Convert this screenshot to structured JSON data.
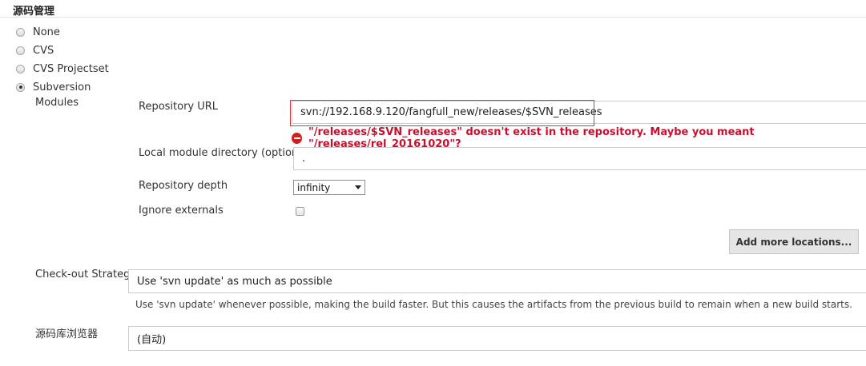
{
  "section": {
    "title": "源码管理"
  },
  "scm_options": [
    {
      "label": "None",
      "selected": false
    },
    {
      "label": "CVS",
      "selected": false
    },
    {
      "label": "CVS Projectset",
      "selected": false
    },
    {
      "label": "Subversion",
      "selected": true
    }
  ],
  "modules": {
    "label": "Modules",
    "repository_url_label": "Repository URL",
    "repository_url_value": "svn://192.168.9.120/fangfull_new/releases/$SVN_releases",
    "error_message": "\"/releases/$SVN_releases\" doesn't exist in the repository. Maybe you meant \"/releases/rel_20161020\"?",
    "local_dir_label": "Local module directory (optional)",
    "local_dir_value": ".",
    "depth_label": "Repository depth",
    "depth_value": "infinity",
    "ignore_externals_label": "Ignore externals",
    "ignore_externals_checked": false,
    "add_locations_label": "Add more locations..."
  },
  "checkout": {
    "label": "Check-out Strategy",
    "value": "Use 'svn update' as much as possible",
    "help": "Use 'svn update' whenever possible, making the build faster. But this causes the artifacts from the previous build to remain when a new build starts."
  },
  "browser": {
    "label": "源码库浏览器",
    "value": "(自动)"
  },
  "colors": {
    "error": "#c8102e",
    "highlight_border": "#d43b3b"
  }
}
